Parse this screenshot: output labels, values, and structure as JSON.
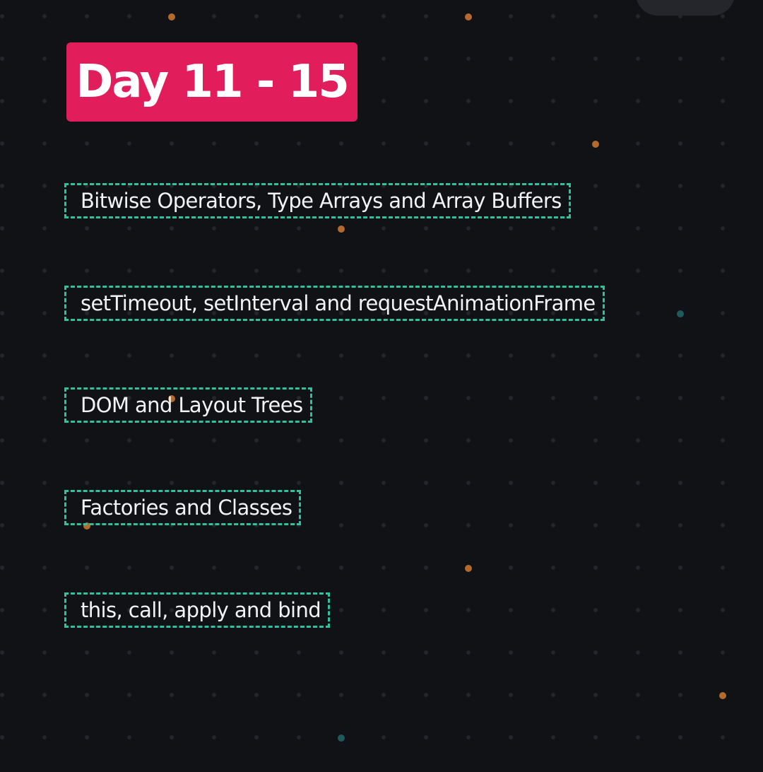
{
  "title": "Day 11 - 15",
  "colors": {
    "background": "#111216",
    "title_badge": "#e11d5c",
    "dashed_border": "#2fc2a0",
    "dot_orange": "#b46a2c",
    "dot_teal": "#1e5a5a"
  },
  "topics": [
    "Bitwise Operators, Type Arrays and Array Buffers",
    "setTimeout, setInterval and requestAnimationFrame",
    "DOM and Layout Trees",
    "Factories and Classes",
    "this, call, apply and bind"
  ]
}
